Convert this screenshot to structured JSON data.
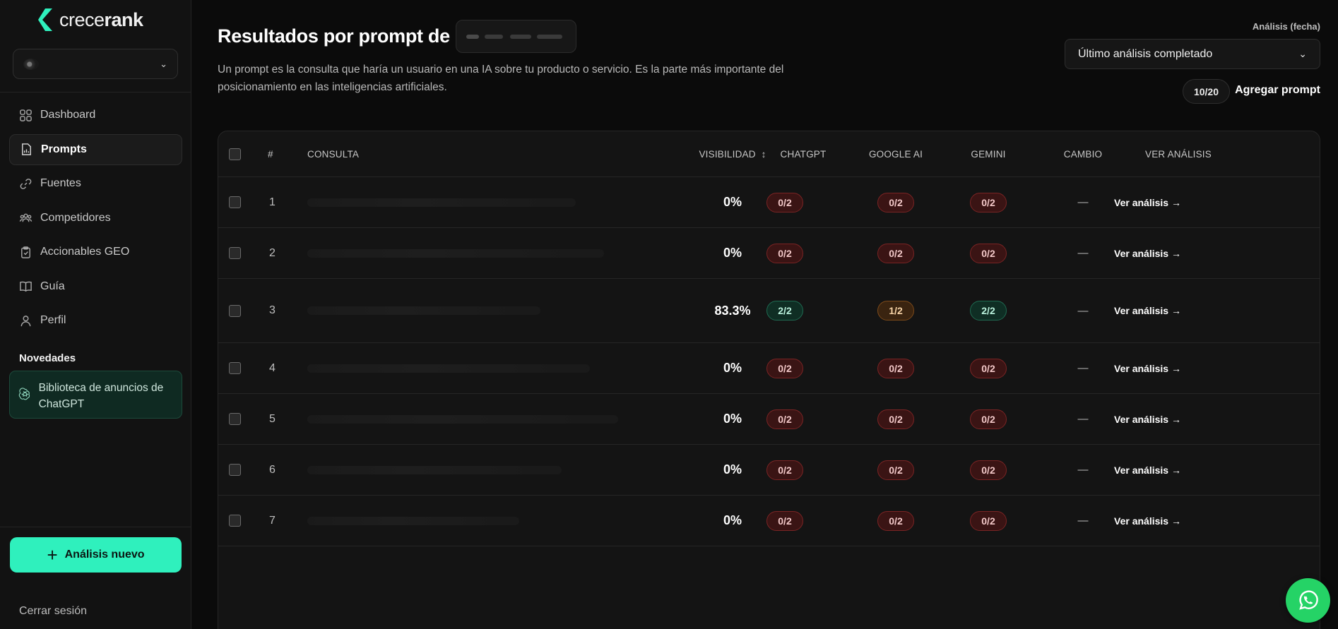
{
  "brand": {
    "name_light": "crece",
    "name_bold": "rank",
    "accent": "#2ff0bd"
  },
  "sidebar": {
    "items": [
      {
        "label": "Dashboard",
        "icon": "dashboard-icon"
      },
      {
        "label": "Prompts",
        "icon": "file-chart-icon",
        "active": true
      },
      {
        "label": "Fuentes",
        "icon": "link-icon"
      },
      {
        "label": "Competidores",
        "icon": "users-icon"
      },
      {
        "label": "Accionables GEO",
        "icon": "clipboard-check-icon"
      },
      {
        "label": "Guía",
        "icon": "book-icon"
      },
      {
        "label": "Perfil",
        "icon": "user-icon"
      }
    ],
    "section_label": "Novedades",
    "promo_label": "Biblioteca de anuncios de ChatGPT",
    "new_analysis_label": "Análisis nuevo",
    "logout_label": "Cerrar sesión"
  },
  "header": {
    "title": "Resultados por prompt de",
    "description": "Un prompt es la consulta que haría un usuario en una IA sobre tu producto o servicio. Es la parte más importante del posicionamiento en las inteligencias artificiales.",
    "date_label": "Análisis (fecha)",
    "date_value": "Último análisis completado",
    "quota": "10/20",
    "add_prompt_label": "Agregar prompt"
  },
  "table": {
    "columns": {
      "num": "#",
      "query": "CONSULTA",
      "visibility": "VISIBILIDAD",
      "chatgpt": "CHATGPT",
      "google": "GOOGLE AI",
      "gemini": "GEMINI",
      "change": "CAMBIO",
      "analysis": "VER ANÁLISIS"
    },
    "sort_indicator": "↕",
    "rows": [
      {
        "num": "1",
        "visibility": "0%",
        "chatgpt": "0/2",
        "google": "0/2",
        "gemini": "0/2",
        "change": "—",
        "link": "Ver análisis →"
      },
      {
        "num": "2",
        "visibility": "0%",
        "chatgpt": "0/2",
        "google": "0/2",
        "gemini": "0/2",
        "change": "—",
        "link": "Ver análisis →"
      },
      {
        "num": "3",
        "visibility": "83.3%",
        "chatgpt": "2/2",
        "google": "1/2",
        "gemini": "2/2",
        "change": "—",
        "link": "Ver análisis →"
      },
      {
        "num": "4",
        "visibility": "0%",
        "chatgpt": "0/2",
        "google": "0/2",
        "gemini": "0/2",
        "change": "—",
        "link": "Ver análisis →"
      },
      {
        "num": "5",
        "visibility": "0%",
        "chatgpt": "0/2",
        "google": "0/2",
        "gemini": "0/2",
        "change": "—",
        "link": "Ver análisis →"
      },
      {
        "num": "6",
        "visibility": "0%",
        "chatgpt": "0/2",
        "google": "0/2",
        "gemini": "0/2",
        "change": "—",
        "link": "Ver análisis →"
      },
      {
        "num": "7",
        "visibility": "0%",
        "chatgpt": "0/2",
        "google": "0/2",
        "gemini": "0/2",
        "change": "—",
        "link": "Ver análisis →"
      }
    ]
  },
  "status_colors": {
    "fail": "#7a2424",
    "partial": "#7c4a1a",
    "success": "#1f6a51"
  }
}
